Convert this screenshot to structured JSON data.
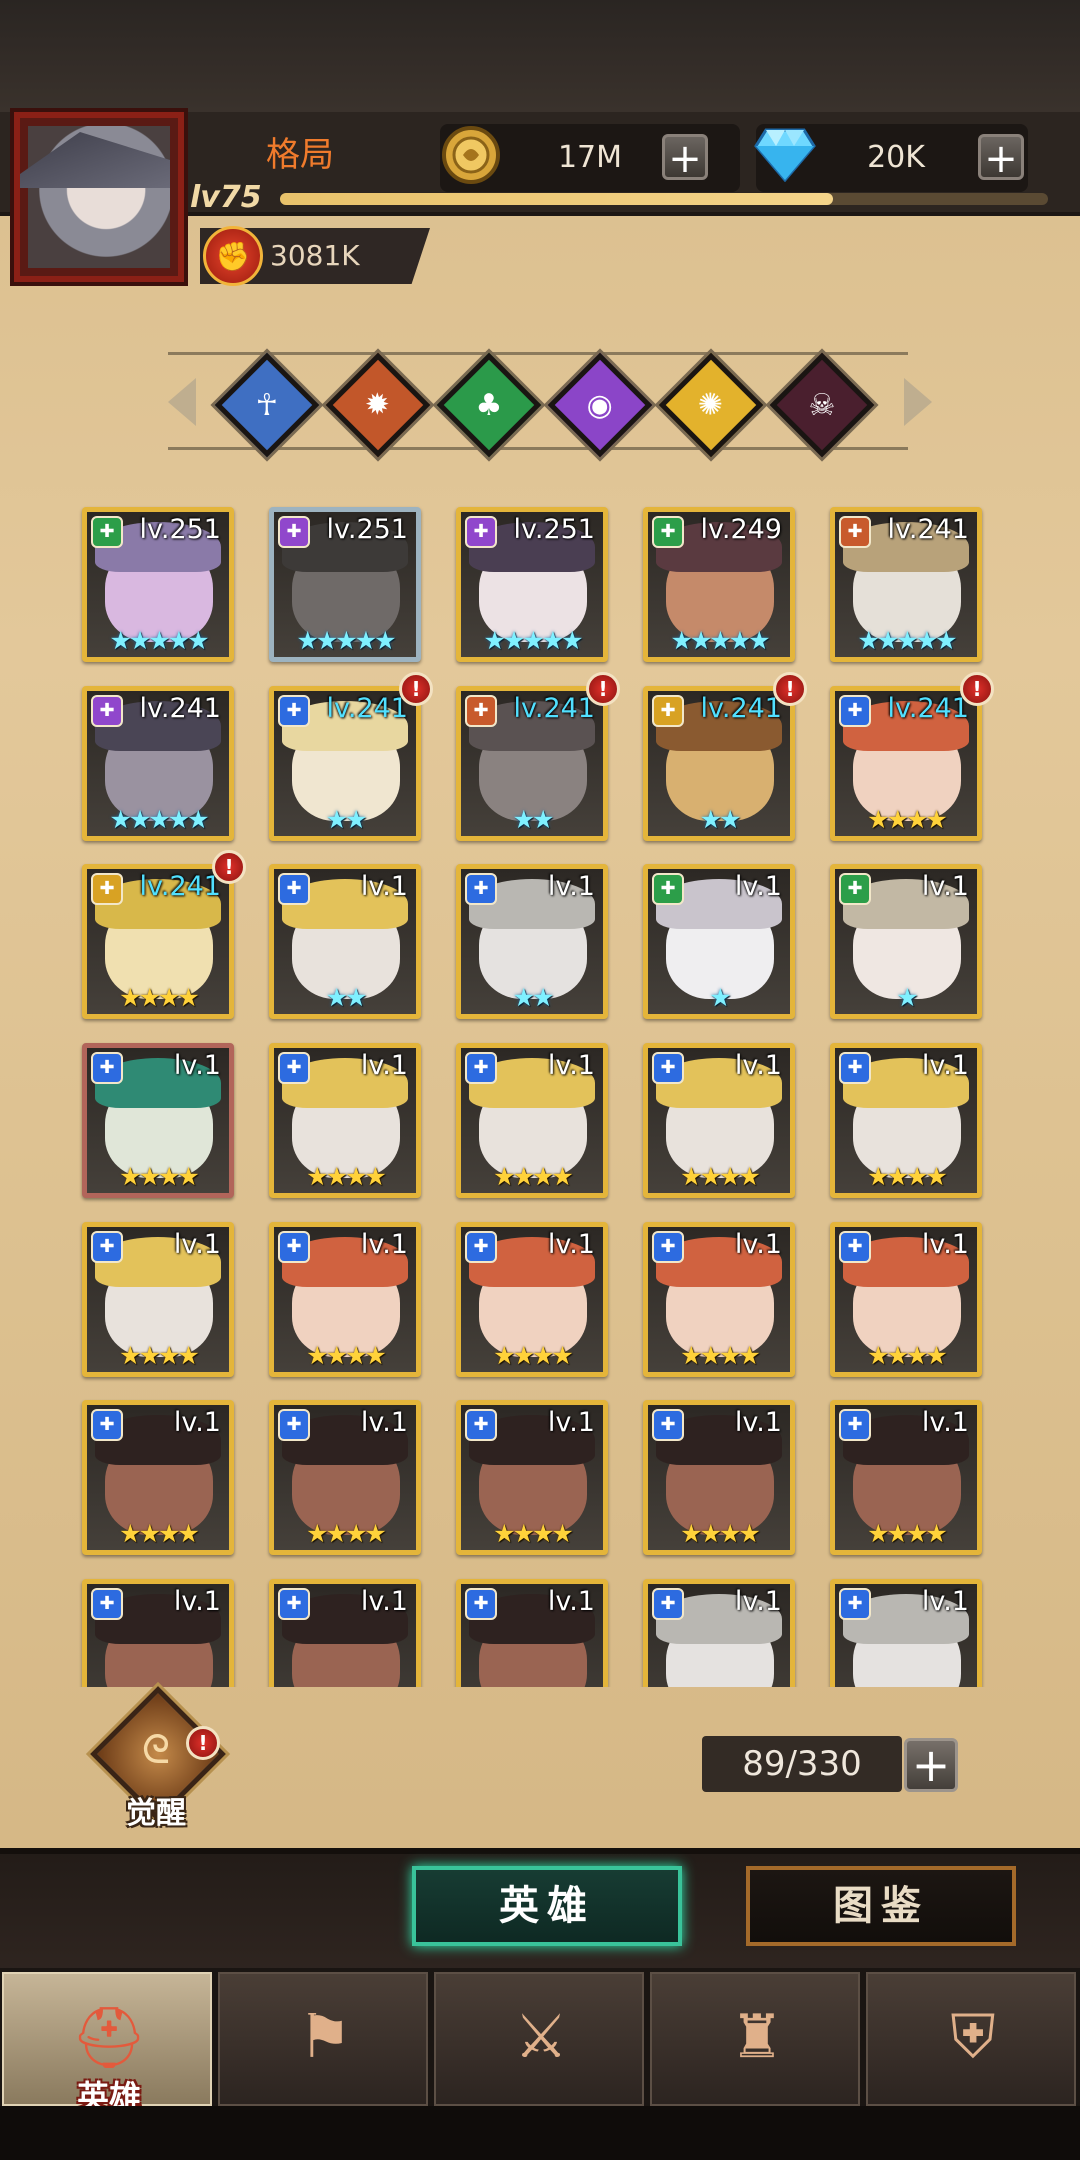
{
  "player": {
    "name": "格局",
    "level": "lv75",
    "xp_fraction": 0.72,
    "power_value": "3081K"
  },
  "resources": {
    "gold": {
      "value": "17M",
      "icon": "gold-coin-icon"
    },
    "diamond": {
      "value": "20K",
      "icon": "diamond-icon"
    }
  },
  "faction_filters": [
    {
      "icon": "ankh-icon",
      "color": "#3f6fc2"
    },
    {
      "icon": "cog-icon",
      "color": "#c2572a"
    },
    {
      "icon": "clover-icon",
      "color": "#2b9a4a"
    },
    {
      "icon": "eye-icon",
      "color": "#8b45c8"
    },
    {
      "icon": "sun-icon",
      "color": "#e3b22c"
    },
    {
      "icon": "skull-icon",
      "color": "#4a1f2e"
    }
  ],
  "faction_colors": {
    "blue": "#2d6be0",
    "orange": "#c85a2c",
    "green": "#2c9e49",
    "purple": "#9047cc",
    "yellow": "#d8a223",
    "dark": "#4b2235"
  },
  "heroes": [
    {
      "level": "lv.251",
      "stars": "★★★★★",
      "star_color": "cyan",
      "level_color": "white",
      "faction": "green",
      "frame": "gold",
      "alert": false
    },
    {
      "level": "lv.251",
      "stars": "★★★★★",
      "star_color": "cyan",
      "level_color": "white",
      "faction": "purple",
      "frame": "silver",
      "alert": false
    },
    {
      "level": "lv.251",
      "stars": "★★★★★",
      "star_color": "cyan",
      "level_color": "white",
      "faction": "purple",
      "frame": "gold",
      "alert": false
    },
    {
      "level": "lv.249",
      "stars": "★★★★★",
      "star_color": "cyan",
      "level_color": "white",
      "faction": "green",
      "frame": "gold",
      "alert": false
    },
    {
      "level": "lv.241",
      "stars": "★★★★★",
      "star_color": "cyan",
      "level_color": "white",
      "faction": "orange",
      "frame": "gold",
      "alert": false
    },
    {
      "level": "lv.241",
      "stars": "★★★★★",
      "star_color": "cyan",
      "level_color": "white",
      "faction": "purple",
      "frame": "gold",
      "alert": false
    },
    {
      "level": "lv.241",
      "stars": "★★",
      "star_color": "cyan",
      "level_color": "cyan",
      "faction": "blue",
      "frame": "gold",
      "alert": true
    },
    {
      "level": "lv.241",
      "stars": "★★",
      "star_color": "cyan",
      "level_color": "cyan",
      "faction": "orange",
      "frame": "gold",
      "alert": true
    },
    {
      "level": "lv.241",
      "stars": "★★",
      "star_color": "cyan",
      "level_color": "cyan",
      "faction": "yellow",
      "frame": "gold",
      "alert": true
    },
    {
      "level": "lv.241",
      "stars": "★★★★",
      "star_color": "gold",
      "level_color": "cyan",
      "faction": "blue",
      "frame": "gold",
      "alert": true
    },
    {
      "level": "lv.241",
      "stars": "★★★★",
      "star_color": "gold",
      "level_color": "cyan",
      "faction": "yellow",
      "frame": "gold",
      "alert": true
    },
    {
      "level": "lv.1",
      "stars": "★★",
      "star_color": "cyan",
      "level_color": "white",
      "faction": "blue",
      "frame": "gold",
      "alert": false
    },
    {
      "level": "lv.1",
      "stars": "★★",
      "star_color": "cyan",
      "level_color": "white",
      "faction": "blue",
      "frame": "gold",
      "alert": false
    },
    {
      "level": "lv.1",
      "stars": "★",
      "star_color": "cyan",
      "level_color": "white",
      "faction": "green",
      "frame": "gold",
      "alert": false
    },
    {
      "level": "lv.1",
      "stars": "★",
      "star_color": "cyan",
      "level_color": "white",
      "faction": "green",
      "frame": "gold",
      "alert": false
    },
    {
      "level": "lv.1",
      "stars": "★★★★",
      "star_color": "gold",
      "level_color": "white",
      "faction": "blue",
      "frame": "bronze",
      "alert": false
    },
    {
      "level": "lv.1",
      "stars": "★★★★",
      "star_color": "gold",
      "level_color": "white",
      "faction": "blue",
      "frame": "gold",
      "alert": false
    },
    {
      "level": "lv.1",
      "stars": "★★★★",
      "star_color": "gold",
      "level_color": "white",
      "faction": "blue",
      "frame": "gold",
      "alert": false
    },
    {
      "level": "lv.1",
      "stars": "★★★★",
      "star_color": "gold",
      "level_color": "white",
      "faction": "blue",
      "frame": "gold",
      "alert": false
    },
    {
      "level": "lv.1",
      "stars": "★★★★",
      "star_color": "gold",
      "level_color": "white",
      "faction": "blue",
      "frame": "gold",
      "alert": false
    },
    {
      "level": "lv.1",
      "stars": "★★★★",
      "star_color": "gold",
      "level_color": "white",
      "faction": "blue",
      "frame": "gold",
      "alert": false
    },
    {
      "level": "lv.1",
      "stars": "★★★★",
      "star_color": "gold",
      "level_color": "white",
      "faction": "blue",
      "frame": "gold",
      "alert": false
    },
    {
      "level": "lv.1",
      "stars": "★★★★",
      "star_color": "gold",
      "level_color": "white",
      "faction": "blue",
      "frame": "gold",
      "alert": false
    },
    {
      "level": "lv.1",
      "stars": "★★★★",
      "star_color": "gold",
      "level_color": "white",
      "faction": "blue",
      "frame": "gold",
      "alert": false
    },
    {
      "level": "lv.1",
      "stars": "★★★★",
      "star_color": "gold",
      "level_color": "white",
      "faction": "blue",
      "frame": "gold",
      "alert": false
    },
    {
      "level": "lv.1",
      "stars": "★★★★",
      "star_color": "gold",
      "level_color": "white",
      "faction": "blue",
      "frame": "gold",
      "alert": false
    },
    {
      "level": "lv.1",
      "stars": "★★★★",
      "star_color": "gold",
      "level_color": "white",
      "faction": "blue",
      "frame": "gold",
      "alert": false
    },
    {
      "level": "lv.1",
      "stars": "★★★★",
      "star_color": "gold",
      "level_color": "white",
      "faction": "blue",
      "frame": "gold",
      "alert": false
    },
    {
      "level": "lv.1",
      "stars": "★★★★",
      "star_color": "gold",
      "level_color": "white",
      "faction": "blue",
      "frame": "gold",
      "alert": false
    },
    {
      "level": "lv.1",
      "stars": "★★★★",
      "star_color": "gold",
      "level_color": "white",
      "faction": "blue",
      "frame": "gold",
      "alert": false
    },
    {
      "level": "lv.1",
      "stars": "",
      "star_color": "gold",
      "level_color": "white",
      "faction": "blue",
      "frame": "gold",
      "alert": false
    },
    {
      "level": "lv.1",
      "stars": "",
      "star_color": "gold",
      "level_color": "white",
      "faction": "blue",
      "frame": "gold",
      "alert": false
    },
    {
      "level": "lv.1",
      "stars": "",
      "star_color": "gold",
      "level_color": "white",
      "faction": "blue",
      "frame": "gold",
      "alert": false
    },
    {
      "level": "lv.1",
      "stars": "",
      "star_color": "gold",
      "level_color": "white",
      "faction": "blue",
      "frame": "gold",
      "alert": false
    },
    {
      "level": "lv.1",
      "stars": "",
      "star_color": "gold",
      "level_color": "white",
      "faction": "blue",
      "frame": "gold",
      "alert": false
    }
  ],
  "awaken": {
    "label": "觉醒",
    "icon": "awaken-rune-icon",
    "alert": true
  },
  "hero_count": "89/330",
  "sub_tabs": {
    "hero": "英雄",
    "atlas": "图鉴"
  },
  "nav": [
    {
      "label": "英雄",
      "icon": "knight-helmet-icon",
      "active": true
    },
    {
      "label": "",
      "icon": "guild-banner-icon",
      "active": false
    },
    {
      "label": "",
      "icon": "crossed-swords-icon",
      "active": false
    },
    {
      "label": "",
      "icon": "tower-icon",
      "active": false
    },
    {
      "label": "",
      "icon": "handshake-shield-icon",
      "active": false
    }
  ],
  "alert_mark": "!"
}
